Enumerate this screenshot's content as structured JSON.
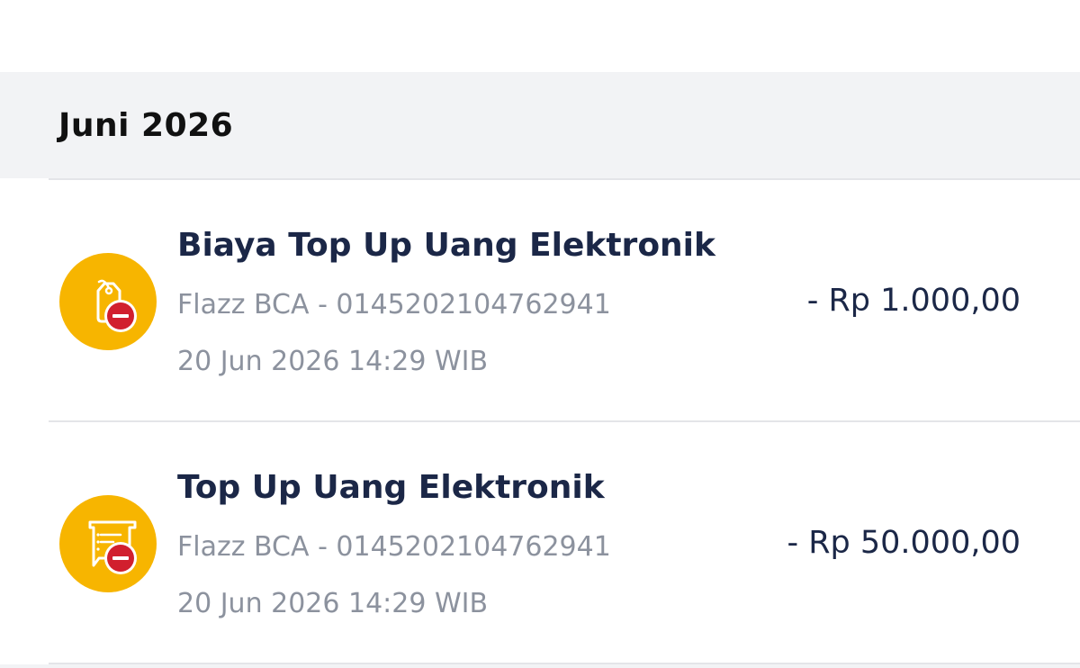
{
  "colors": {
    "icon_bg": "#f7b500",
    "minus_badge": "#d11f2e",
    "title_text": "#1b2747",
    "secondary_text": "#8c929e",
    "section_bg": "#f2f3f5"
  },
  "section": {
    "month_label": "Juni 2026"
  },
  "transactions": [
    {
      "icon": "price-tag-minus-icon",
      "title": "Biaya Top Up Uang Elektronik",
      "subtitle": "Flazz BCA - 0145202104762941",
      "datetime": "20 Jun 2026 14:29 WIB",
      "amount": "- Rp 1.000,00"
    },
    {
      "icon": "receipt-minus-icon",
      "title": "Top Up Uang Elektronik",
      "subtitle": "Flazz BCA - 0145202104762941",
      "datetime": "20 Jun 2026 14:29 WIB",
      "amount": "- Rp 50.000,00"
    }
  ]
}
